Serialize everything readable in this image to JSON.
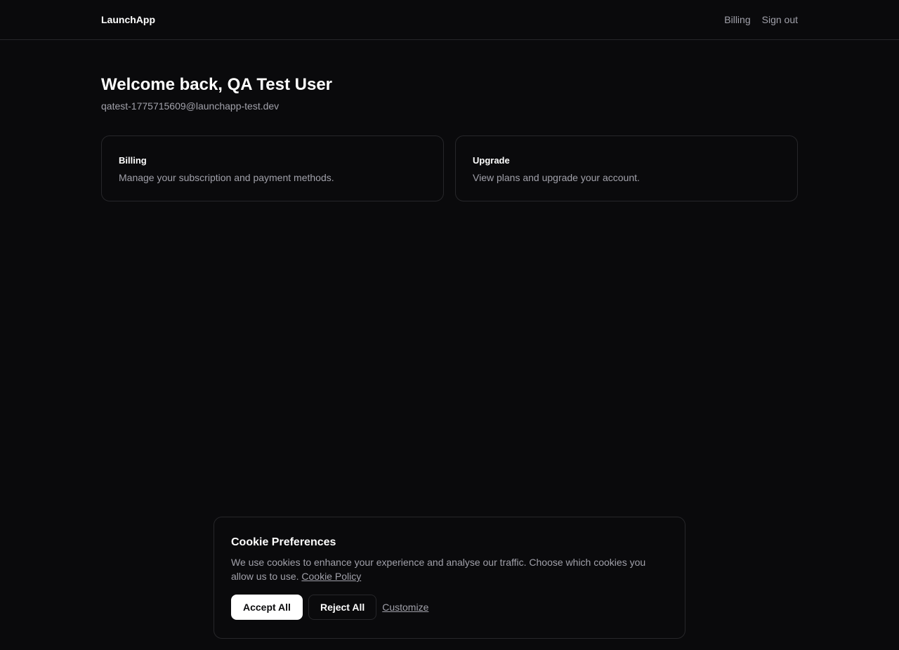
{
  "header": {
    "brand": "LaunchApp",
    "nav": [
      {
        "label": "Billing"
      },
      {
        "label": "Sign out"
      }
    ]
  },
  "main": {
    "welcome": "Welcome back, QA Test User",
    "email": "qatest-1775715609@launchapp-test.dev",
    "cards": [
      {
        "title": "Billing",
        "description": "Manage your subscription and payment methods."
      },
      {
        "title": "Upgrade",
        "description": "View plans and upgrade your account."
      }
    ]
  },
  "cookie_banner": {
    "title": "Cookie Preferences",
    "text": "We use cookies to enhance your experience and analyse our traffic. Choose which cookies you allow us to use.",
    "policy_link": "Cookie Policy",
    "accept_label": "Accept All",
    "reject_label": "Reject All",
    "customize_label": "Customize"
  },
  "colors": {
    "background": "#0a0a0c",
    "border": "#27272a",
    "muted_text": "#a1a1aa",
    "primary_text": "#ffffff"
  }
}
